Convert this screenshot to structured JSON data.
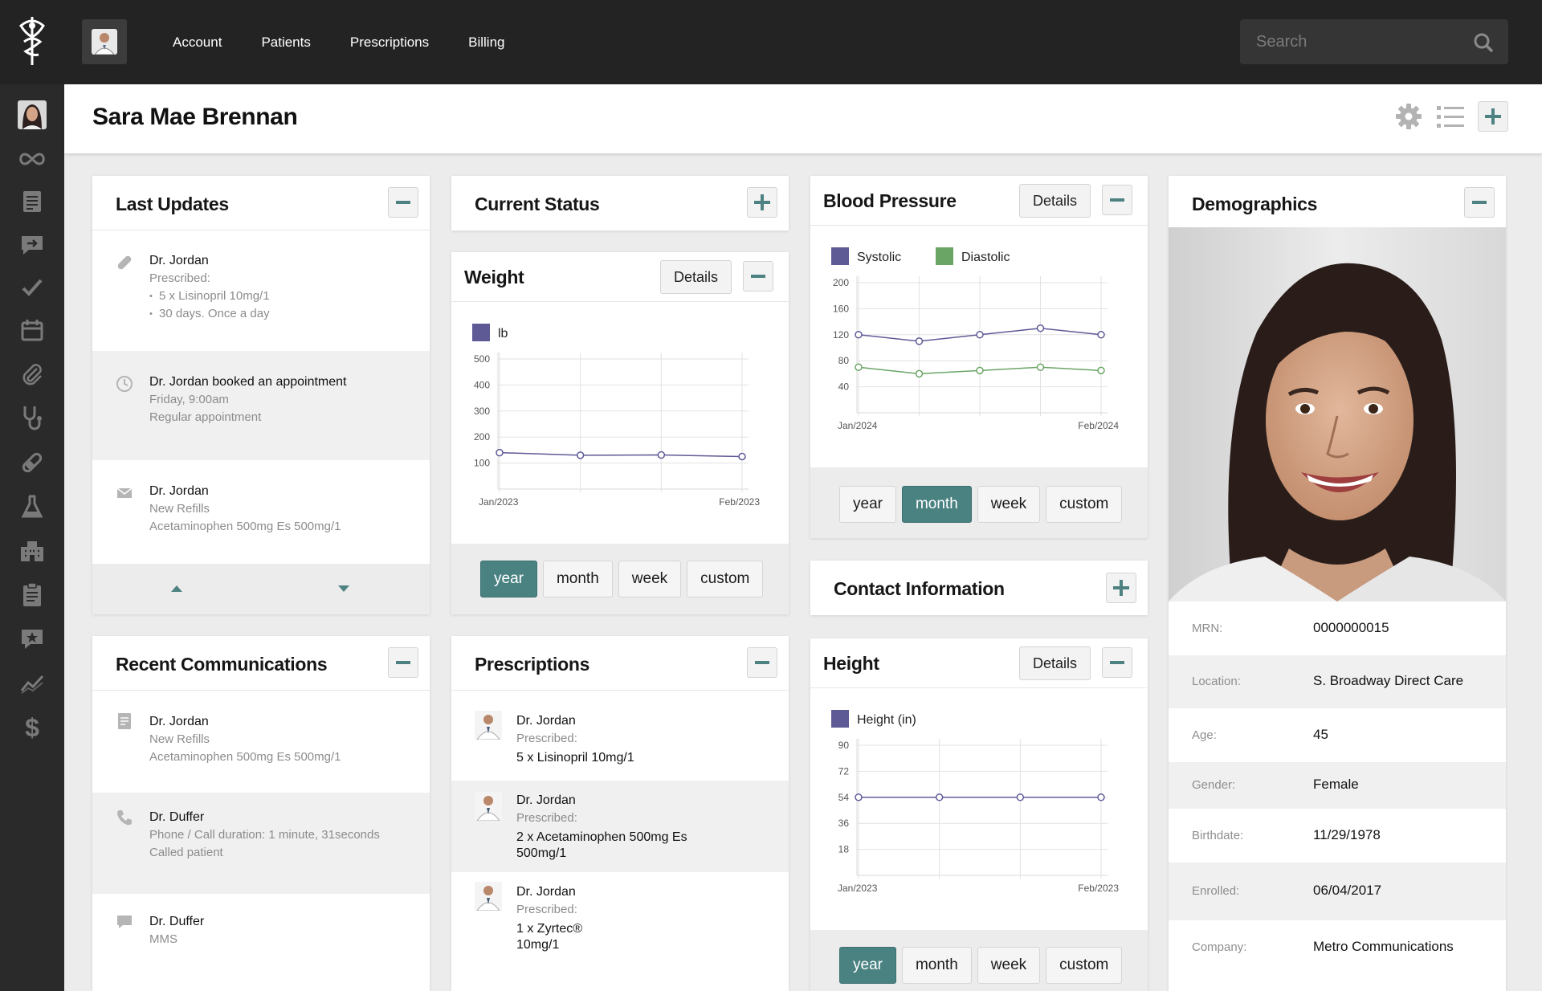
{
  "nav": {
    "items": [
      "Account",
      "Patients",
      "Prescriptions",
      "Billing"
    ],
    "search_placeholder": "Search"
  },
  "patient": {
    "name": "Sara Mae Brennan"
  },
  "last_updates": {
    "title": "Last Updates",
    "items": [
      {
        "icon": "pill-icon",
        "lines": [
          "Dr. Jordan",
          "Prescribed:"
        ],
        "bullets": [
          "5 x Lisinopril 10mg/1",
          "30 days. Once a day"
        ]
      },
      {
        "icon": "clock-icon",
        "lines": [
          "Dr. Jordan booked an appointment",
          "Friday, 9:00am",
          "Regular appointment"
        ]
      },
      {
        "icon": "envelope-icon",
        "lines": [
          "Dr. Jordan",
          "New Refills",
          "Acetaminophen 500mg Es 500mg/1"
        ]
      }
    ]
  },
  "recent_communications": {
    "title": "Recent Communications",
    "items": [
      {
        "icon": "document-icon",
        "lines": [
          "Dr. Jordan",
          "New Refills",
          "Acetaminophen 500mg Es 500mg/1"
        ]
      },
      {
        "icon": "phone-icon",
        "lines": [
          "Dr. Duffer",
          "Phone / Call duration: 1 minute, 31seconds",
          "Called patient"
        ]
      },
      {
        "icon": "chat-bubble-icon",
        "lines": [
          "Dr. Duffer",
          "MMS"
        ]
      }
    ]
  },
  "current_status": {
    "title": "Current Status"
  },
  "weight": {
    "title": "Weight",
    "details_label": "Details",
    "ranges": [
      "year",
      "month",
      "week",
      "custom"
    ],
    "active_range": "year",
    "chart_data": {
      "type": "line",
      "series": [
        {
          "name": "lb",
          "color": "#5e5a96",
          "values": [
            140,
            130,
            131,
            125
          ]
        }
      ],
      "x": [
        "Jan/2023",
        "",
        "",
        "Feb/2023"
      ],
      "x_tick_labels": [
        "Jan/2023",
        "Feb/2023"
      ],
      "yticks": [
        100,
        200,
        300,
        400,
        500
      ],
      "ylim": [
        0,
        500
      ],
      "grid": true,
      "legend": "top-left"
    }
  },
  "prescriptions": {
    "title": "Prescriptions",
    "items": [
      {
        "doctor": "Dr. Jordan",
        "label": "Prescribed:",
        "drug_lines": [
          "5 x Lisinopril 10mg/1"
        ]
      },
      {
        "doctor": "Dr. Jordan",
        "label": "Prescribed:",
        "drug_lines": [
          "2 x Acetaminophen 500mg Es",
          "500mg/1"
        ]
      },
      {
        "doctor": "Dr. Jordan",
        "label": "Prescribed:",
        "drug_lines": [
          "1 x Zyrtec®",
          "10mg/1"
        ]
      }
    ]
  },
  "blood_pressure": {
    "title": "Blood Pressure",
    "details_label": "Details",
    "ranges": [
      "year",
      "month",
      "week",
      "custom"
    ],
    "active_range": "month",
    "chart_data": {
      "type": "line",
      "series": [
        {
          "name": "Systolic",
          "color": "#5e5a96",
          "values": [
            120,
            110,
            120,
            130,
            120
          ]
        },
        {
          "name": "Diastolic",
          "color": "#6aa566",
          "values": [
            70,
            60,
            65,
            70,
            65
          ]
        }
      ],
      "x": [
        "Jan/2024",
        "",
        "",
        "",
        "Feb/2024"
      ],
      "x_tick_labels": [
        "Jan/2024",
        "Feb/2024"
      ],
      "yticks": [
        40,
        80,
        120,
        160,
        200
      ],
      "ylim": [
        0,
        200
      ],
      "grid": true,
      "legend": "top-left"
    }
  },
  "contact_information": {
    "title": "Contact Information"
  },
  "height": {
    "title": "Height",
    "details_label": "Details",
    "ranges": [
      "year",
      "month",
      "week",
      "custom"
    ],
    "active_range": "year",
    "chart_data": {
      "type": "line",
      "series": [
        {
          "name": "Height (in)",
          "color": "#5e5a96",
          "values": [
            54,
            54,
            54,
            54
          ]
        }
      ],
      "x": [
        "Jan/2023",
        "",
        "",
        "Feb/2023"
      ],
      "x_tick_labels": [
        "Jan/2023",
        "Feb/2023"
      ],
      "yticks": [
        18,
        36,
        54,
        72,
        90
      ],
      "ylim": [
        0,
        90
      ],
      "grid": true,
      "legend": "top-left"
    }
  },
  "demographics": {
    "title": "Demographics",
    "fields": [
      {
        "label": "MRN:",
        "value": "0000000015"
      },
      {
        "label": "Location:",
        "value": "S. Broadway Direct Care"
      },
      {
        "label": "Age:",
        "value": "45"
      },
      {
        "label": "Gender:",
        "value": "Female"
      },
      {
        "label": "Birthdate:",
        "value": "11/29/1978"
      },
      {
        "label": "Enrolled:",
        "value": "06/04/2017"
      },
      {
        "label": "Company:",
        "value": "Metro Communications"
      }
    ]
  },
  "colors": {
    "accent": "#4a8282",
    "topbar": "#232323",
    "sidebar": "#2a2a2a",
    "series_primary": "#5e5a96",
    "series_secondary": "#6aa566"
  }
}
